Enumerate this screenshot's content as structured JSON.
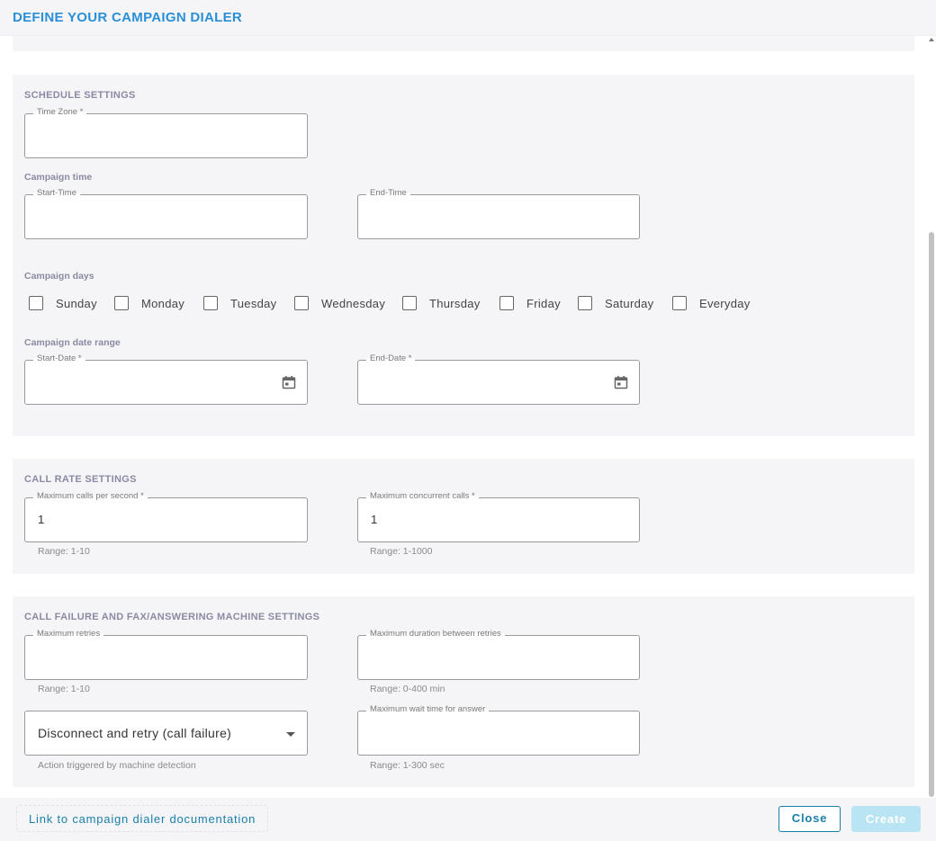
{
  "header": {
    "title": "DEFINE YOUR CAMPAIGN DIALER"
  },
  "schedule": {
    "title": "SCHEDULE SETTINGS",
    "time_zone": {
      "label": "Time Zone *",
      "value": ""
    },
    "campaign_time_label": "Campaign time",
    "start_time": {
      "label": "Start-Time",
      "value": ""
    },
    "end_time": {
      "label": "End-Time",
      "value": ""
    },
    "campaign_days_label": "Campaign days",
    "days": [
      {
        "label": "Sunday",
        "checked": false
      },
      {
        "label": "Monday",
        "checked": false
      },
      {
        "label": "Tuesday",
        "checked": false
      },
      {
        "label": "Wednesday",
        "checked": false
      },
      {
        "label": "Thursday",
        "checked": false
      },
      {
        "label": "Friday",
        "checked": false
      },
      {
        "label": "Saturday",
        "checked": false
      },
      {
        "label": "Everyday",
        "checked": false
      }
    ],
    "date_range_label": "Campaign date range",
    "start_date": {
      "label": "Start-Date *",
      "value": ""
    },
    "end_date": {
      "label": "End-Date *",
      "value": ""
    }
  },
  "call_rate": {
    "title": "CALL RATE SETTINGS",
    "max_cps": {
      "label": "Maximum calls per second *",
      "value": "1",
      "help": "Range: 1-10"
    },
    "max_concurrent": {
      "label": "Maximum concurrent calls *",
      "value": "1",
      "help": "Range: 1-1000"
    }
  },
  "failure": {
    "title": "CALL FAILURE AND FAX/ANSWERING MACHINE SETTINGS",
    "max_retries": {
      "label": "Maximum retries",
      "value": "",
      "help": "Range: 1-10"
    },
    "max_duration": {
      "label": "Maximum duration between retries",
      "value": "",
      "help": "Range: 0-400 min"
    },
    "action": {
      "value": "Disconnect and retry (call failure)",
      "help": "Action triggered by machine detection"
    },
    "max_wait": {
      "label": "Maximum wait time for answer",
      "value": "",
      "help": "Range: 1-300 sec"
    }
  },
  "footer": {
    "doc_link": "Link to campaign dialer documentation",
    "close": "Close",
    "create": "Create"
  },
  "icons": {
    "calendar": "calendar-icon",
    "dropdown": "chevron-down-icon"
  },
  "colors": {
    "accent": "#1a7fa8",
    "title": "#2a8fd6",
    "section_bg": "#f5f5f7",
    "create_disabled": "#b9e4f3"
  }
}
